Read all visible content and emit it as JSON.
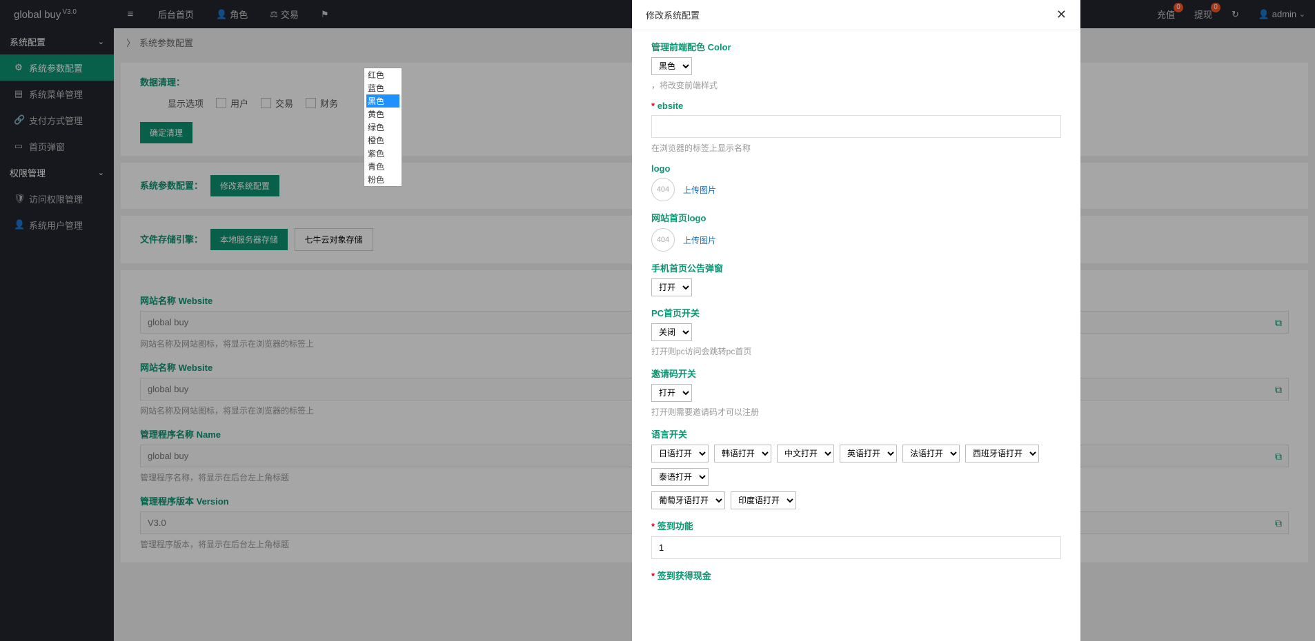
{
  "logo": {
    "name": "global buy",
    "version": "V3.0"
  },
  "topnav": [
    {
      "icon": "≡"
    },
    {
      "label": "后台首页",
      "icon": ""
    },
    {
      "label": "角色",
      "icon": "◡"
    },
    {
      "label": "交易",
      "icon": "⚖"
    },
    {
      "label": "",
      "icon": "⚑"
    }
  ],
  "topright": {
    "recharge": {
      "label": "充值",
      "count": "0"
    },
    "withdraw": {
      "label": "提现",
      "count": "0"
    },
    "refresh_icon": "↻",
    "user_icon": "◡",
    "username": "admin"
  },
  "sidebar": {
    "group1": {
      "title": "系统配置"
    },
    "items1": [
      {
        "icon": "⚙",
        "label": "系统参数配置"
      },
      {
        "icon": "▤",
        "label": "系统菜单管理"
      },
      {
        "icon": "🔗",
        "label": "支付方式管理"
      },
      {
        "icon": "▭",
        "label": "首页弹窗"
      }
    ],
    "group2": {
      "title": "权限管理"
    },
    "items2": [
      {
        "icon": "🛡",
        "label": "访问权限管理"
      },
      {
        "icon": "◡",
        "label": "系统用户管理"
      }
    ]
  },
  "breadcrumb": "系统参数配置",
  "panels": {
    "cleanup": {
      "title": "数据清理：",
      "opt_label": "显示选项",
      "checks": [
        "用户",
        "交易",
        "财务"
      ],
      "confirm": "确定清理"
    },
    "syscfg": {
      "title": "系统参数配置：",
      "btn": "修改系统配置"
    },
    "storage": {
      "title": "文件存储引擎：",
      "btn1": "本地服务器存储",
      "btn2": "七牛云对象存储"
    }
  },
  "fields": [
    {
      "title": "网站名称 Website",
      "value": "global buy",
      "hint": "网站名称及网站图标，将显示在浏览器的标签上"
    },
    {
      "title": "网站名称 Website",
      "value": "global buy",
      "hint": "网站名称及网站图标，将显示在浏览器的标签上"
    },
    {
      "title": "管理程序名称 Name",
      "value": "global buy",
      "hint": "管理程序名称，将显示在后台左上角标题"
    },
    {
      "title": "管理程序版本 Version",
      "value": "V3.0",
      "hint": "管理程序版本，将显示在后台左上角标题"
    }
  ],
  "drawer": {
    "title": "修改系统配置",
    "color": {
      "label": "管理前端配色 Color",
      "value": "黑色",
      "hint": "，将改变前端样式"
    },
    "color_options": [
      "红色",
      "蓝色",
      "黑色",
      "黄色",
      "绿色",
      "橙色",
      "紫色",
      "青色",
      "粉色"
    ],
    "website": {
      "label": "ebsite",
      "value": "",
      "hint": "在浏览器的标签上显示名称"
    },
    "logo1": {
      "label": "logo",
      "upload": "上传图片",
      "thumb": "404"
    },
    "logo2": {
      "label": "网站首页logo",
      "upload": "上传图片",
      "thumb": "404"
    },
    "popup": {
      "label": "手机首页公告弹窗",
      "value": "打开"
    },
    "pc": {
      "label": "PC首页开关",
      "value": "关闭",
      "hint": "打开则pc访问会跳转pc首页"
    },
    "invite": {
      "label": "邀请码开关",
      "value": "打开",
      "hint": "打开则需要邀请码才可以注册"
    },
    "lang": {
      "label": "语言开关",
      "opts": [
        "日语打开",
        "韩语打开",
        "中文打开",
        "英语打开",
        "法语打开",
        "西班牙语打开",
        "泰语打开",
        "葡萄牙语打开",
        "印度语打开"
      ]
    },
    "sign": {
      "label": "签到功能",
      "value": "1"
    },
    "signcash": {
      "label": "签到获得现金"
    }
  }
}
